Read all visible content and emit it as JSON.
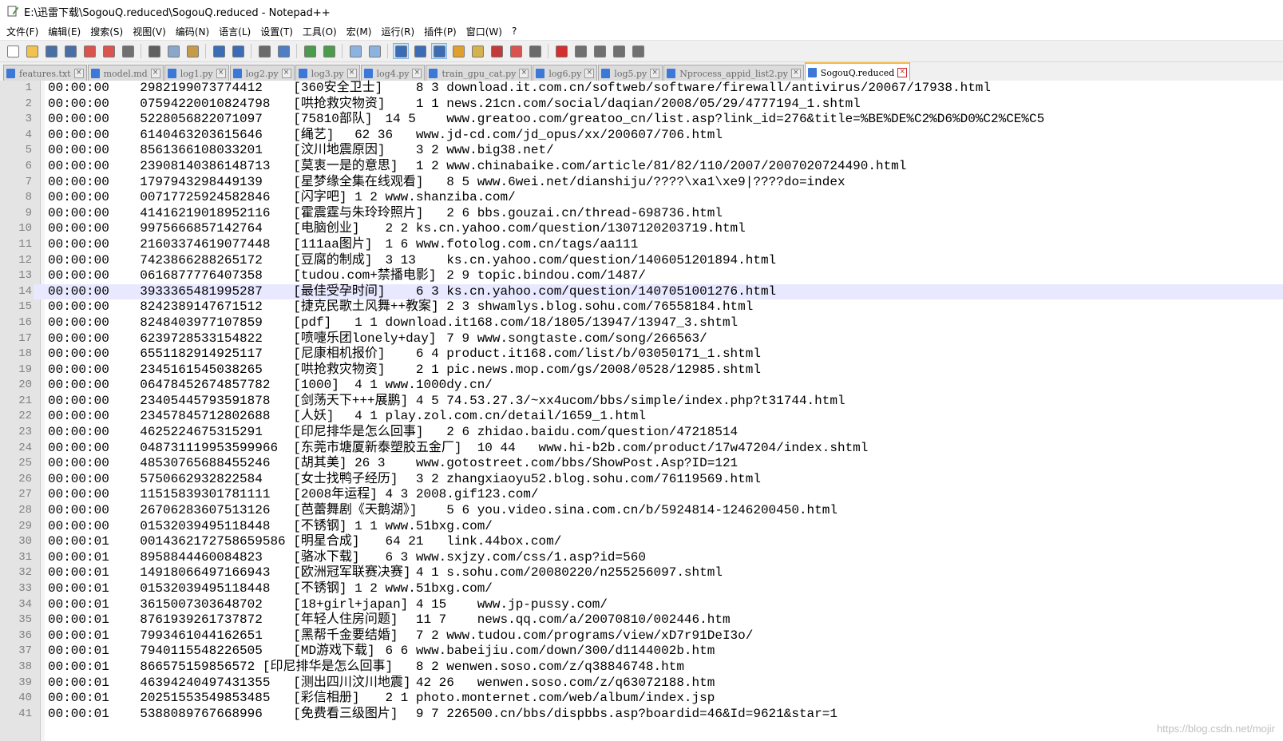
{
  "window": {
    "title": "E:\\迅雷下载\\SogouQ.reduced\\SogouQ.reduced - Notepad++"
  },
  "menu": [
    "文件(F)",
    "编辑(E)",
    "搜索(S)",
    "视图(V)",
    "编码(N)",
    "语言(L)",
    "设置(T)",
    "工具(O)",
    "宏(M)",
    "运行(R)",
    "插件(P)",
    "窗口(W)",
    "?"
  ],
  "toolbar": {
    "buttons": [
      {
        "name": "new-file-icon",
        "color": "#ffffff"
      },
      {
        "name": "open-file-icon",
        "color": "#f2c14e"
      },
      {
        "name": "save-icon",
        "color": "#4a6fa5"
      },
      {
        "name": "save-all-icon",
        "color": "#4a6fa5"
      },
      {
        "name": "close-icon",
        "color": "#d9534f"
      },
      {
        "name": "close-all-icon",
        "color": "#d9534f"
      },
      {
        "name": "print-icon",
        "color": "#707070"
      },
      {
        "sep": true
      },
      {
        "name": "cut-icon",
        "color": "#606060"
      },
      {
        "name": "copy-icon",
        "color": "#8aa6c8"
      },
      {
        "name": "paste-icon",
        "color": "#c59b4a"
      },
      {
        "sep": true
      },
      {
        "name": "undo-icon",
        "color": "#3a6db5"
      },
      {
        "name": "redo-icon",
        "color": "#3a6db5"
      },
      {
        "sep": true
      },
      {
        "name": "find-icon",
        "color": "#6b6b6b"
      },
      {
        "name": "replace-icon",
        "color": "#4f7fc2"
      },
      {
        "sep": true
      },
      {
        "name": "zoom-in-icon",
        "color": "#4c9b4c"
      },
      {
        "name": "zoom-out-icon",
        "color": "#4c9b4c"
      },
      {
        "sep": true
      },
      {
        "name": "sync-vertical-icon",
        "color": "#8cb3e0"
      },
      {
        "name": "sync-horizontal-icon",
        "color": "#8cb3e0"
      },
      {
        "sep": true
      },
      {
        "name": "word-wrap-icon",
        "color": "#3a6db5",
        "active": true
      },
      {
        "name": "show-all-chars-icon",
        "color": "#3a6db5"
      },
      {
        "name": "indent-guide-icon",
        "color": "#3a6db5",
        "active": true
      },
      {
        "name": "language-icon",
        "color": "#e0a030"
      },
      {
        "name": "document-map-icon",
        "color": "#d4b24c"
      },
      {
        "name": "function-list-icon",
        "color": "#c23b3b"
      },
      {
        "name": "folder-workspace-icon",
        "color": "#d9534f"
      },
      {
        "name": "monitoring-icon",
        "color": "#6b6b6b"
      },
      {
        "sep": true
      },
      {
        "name": "record-macro-icon",
        "color": "#d32f2f"
      },
      {
        "name": "stop-macro-icon",
        "color": "#707070"
      },
      {
        "name": "play-macro-icon",
        "color": "#707070"
      },
      {
        "name": "run-macro-multiple-icon",
        "color": "#707070"
      },
      {
        "name": "save-macro-icon",
        "color": "#707070"
      }
    ]
  },
  "tabs": [
    {
      "label": "features.txt"
    },
    {
      "label": "model.md"
    },
    {
      "label": "log1.py"
    },
    {
      "label": "log2.py"
    },
    {
      "label": "log3.py"
    },
    {
      "label": "log4.py"
    },
    {
      "label": "train_gpu_cat.py"
    },
    {
      "label": "log6.py"
    },
    {
      "label": "log5.py"
    },
    {
      "label": "Nprocess_appid_list2.py"
    },
    {
      "label": "SogouQ.reduced",
      "active": true
    }
  ],
  "editor": {
    "current_line": 14,
    "lines": [
      {
        "n": "1",
        "text": "00:00:00\t2982199073774412\t[360安全卫士]\t8 3 download.it.com.cn/softweb/software/firewall/antivirus/20067/17938.html"
      },
      {
        "n": "2",
        "text": "00:00:00\t07594220010824798\t[哄抢救灾物资]\t1 1 news.21cn.com/social/daqian/2008/05/29/4777194_1.shtml"
      },
      {
        "n": "3",
        "text": "00:00:00\t5228056822071097\t[75810部队]\t14 5\twww.greatoo.com/greatoo_cn/list.asp?link_id=276&title=%BE%DE%C2%D6%D0%C2%CE%C5"
      },
      {
        "n": "4",
        "text": "00:00:00\t6140463203615646\t[绳艺]\t62 36\twww.jd-cd.com/jd_opus/xx/200607/706.html"
      },
      {
        "n": "5",
        "text": "00:00:00\t8561366108033201\t[汶川地震原因]\t3 2 www.big38.net/"
      },
      {
        "n": "6",
        "text": "00:00:00\t23908140386148713\t[莫衷一是的意思]\t1 2 www.chinabaike.com/article/81/82/110/2007/2007020724490.html"
      },
      {
        "n": "7",
        "text": "00:00:00\t1797943298449139\t[星梦缘全集在线观看]\t8 5 www.6wei.net/dianshiju/????\\xa1\\xe9|????do=index"
      },
      {
        "n": "8",
        "text": "00:00:00\t00717725924582846\t[闪字吧]\t1 2 www.shanziba.com/"
      },
      {
        "n": "9",
        "text": "00:00:00\t41416219018952116\t[霍震霆与朱玲玲照片]\t2 6 bbs.gouzai.cn/thread-698736.html"
      },
      {
        "n": "10",
        "text": "00:00:00\t9975666857142764\t[电脑创业]\t2 2 ks.cn.yahoo.com/question/1307120203719.html"
      },
      {
        "n": "11",
        "text": "00:00:00\t21603374619077448\t[111aa图片]\t1 6 www.fotolog.com.cn/tags/aa111"
      },
      {
        "n": "12",
        "text": "00:00:00\t7423866288265172\t[豆腐的制成]\t3 13\tks.cn.yahoo.com/question/1406051201894.html"
      },
      {
        "n": "13",
        "text": "00:00:00\t0616877776407358\t[tudou.com+禁播电影]\t2 9 topic.bindou.com/1487/"
      },
      {
        "n": "14",
        "text": "00:00:00\t3933365481995287\t[最佳受孕时间]\t6 3 ks.cn.yahoo.com/question/1407051001276.html"
      },
      {
        "n": "15",
        "text": "00:00:00\t8242389147671512\t[捷克民歌土风舞++教案]\t2 3 shwamlys.blog.sohu.com/76558184.html"
      },
      {
        "n": "16",
        "text": "00:00:00\t8248403977107859\t[pdf]\t1 1 download.it168.com/18/1805/13947/13947_3.shtml"
      },
      {
        "n": "17",
        "text": "00:00:00\t6239728533154822\t[喷嚏乐团lonely+day]\t7 9 www.songtaste.com/song/266563/"
      },
      {
        "n": "18",
        "text": "00:00:00\t6551182914925117\t[尼康相机报价]\t6 4 product.it168.com/list/b/03050171_1.shtml"
      },
      {
        "n": "19",
        "text": "00:00:00\t2345161545038265\t[哄抢救灾物资]\t2 1 pic.news.mop.com/gs/2008/0528/12985.shtml"
      },
      {
        "n": "20",
        "text": "00:00:00\t06478452674857782\t[1000]\t4 1 www.1000dy.cn/"
      },
      {
        "n": "21",
        "text": "00:00:00\t23405445793591878\t[剑荡天下+++展鹏]\t4 5 74.53.27.3/~xx4ucom/bbs/simple/index.php?t31744.html"
      },
      {
        "n": "22",
        "text": "00:00:00\t23457845712802688\t[人妖]\t4 1 play.zol.com.cn/detail/1659_1.html"
      },
      {
        "n": "23",
        "text": "00:00:00\t4625224675315291\t[印尼排华是怎么回事]\t2 6 zhidao.baidu.com/question/47218514"
      },
      {
        "n": "24",
        "text": "00:00:00\t048731119953599966\t[东莞市塘厦新泰塑胶五金厂]\t10 44\twww.hi-b2b.com/product/17w47204/index.shtml"
      },
      {
        "n": "25",
        "text": "00:00:00\t48530765688455246\t[胡其美]\t26 3\twww.gotostreet.com/bbs/ShowPost.Asp?ID=121"
      },
      {
        "n": "26",
        "text": "00:00:00\t5750662932822584\t[女士找鸭子经历]\t3 2 zhangxiaoyu52.blog.sohu.com/76119569.html"
      },
      {
        "n": "27",
        "text": "00:00:00\t11515839301781111\t[2008年运程]\t4 3 2008.gif123.com/"
      },
      {
        "n": "28",
        "text": "00:00:00\t26706283607513126\t[芭蕾舞剧《天鹅湖》]\t5 6 you.video.sina.com.cn/b/5924814-1246200450.html"
      },
      {
        "n": "29",
        "text": "00:00:00\t01532039495118448\t[不锈钢]\t1 1 www.51bxg.com/"
      },
      {
        "n": "30",
        "text": "00:00:01\t0014362172758659586\t[明星合成]\t64 21\tlink.44box.com/"
      },
      {
        "n": "31",
        "text": "00:00:01\t8958844460084823\t[骆冰下载]\t6 3 www.sxjzy.com/css/1.asp?id=560"
      },
      {
        "n": "32",
        "text": "00:00:01\t14918066497166943\t[欧洲冠军联赛决赛]\t4 1 s.sohu.com/20080220/n255256097.shtml"
      },
      {
        "n": "33",
        "text": "00:00:01\t01532039495118448\t[不锈钢]\t1 2 www.51bxg.com/"
      },
      {
        "n": "34",
        "text": "00:00:01\t3615007303648702\t[18+girl+japan]\t4 15\twww.jp-pussy.com/"
      },
      {
        "n": "35",
        "text": "00:00:01\t8761939261737872\t[年轻人住房问题]\t11 7\tnews.qq.com/a/20070810/002446.htm"
      },
      {
        "n": "36",
        "text": "00:00:01\t7993461044162651\t[黑帮千金要结婚]\t7 2 www.tudou.com/programs/view/xD7r91DeI3o/"
      },
      {
        "n": "37",
        "text": "00:00:01\t7940115548226505\t[MD游戏下载]\t6 6 www.babeijiu.com/down/300/d1144002b.htm"
      },
      {
        "n": "38",
        "text": "00:00:01\t866575159856572 [印尼排华是怎么回事]\t8 2 wenwen.soso.com/z/q38846748.htm"
      },
      {
        "n": "39",
        "text": "00:00:01\t46394240497431355\t[测出四川汶川地震]\t42 26\twenwen.soso.com/z/q63072188.htm"
      },
      {
        "n": "40",
        "text": "00:00:01\t20251553549853485\t[彩信相册]\t2 1 photo.monternet.com/web/album/index.jsp"
      },
      {
        "n": "41",
        "text": "00:00:01\t5388089767668996\t[免费看三级图片]\t9 7 226500.cn/bbs/dispbbs.asp?boardid=46&Id=9621&star=1"
      }
    ]
  },
  "watermark": "https://blog.csdn.net/mojir"
}
